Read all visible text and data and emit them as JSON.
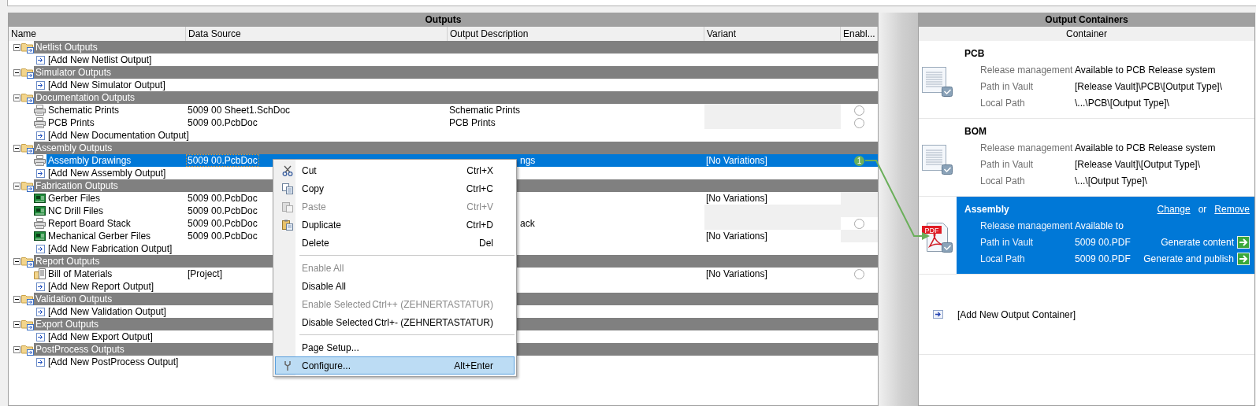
{
  "outputs": {
    "title": "Outputs",
    "columns": [
      "Name",
      "Data Source",
      "Output Description",
      "Variant",
      "Enabl..."
    ],
    "groups": [
      {
        "name": "Netlist Outputs",
        "expanded": true,
        "rows": [
          {
            "kind": "add",
            "name": "[Add New Netlist Output]",
            "selected": false
          }
        ]
      },
      {
        "name": "Simulator Outputs",
        "expanded": true,
        "rows": [
          {
            "kind": "add",
            "name": "[Add New Simulator Output]",
            "selected": false
          }
        ]
      },
      {
        "name": "Documentation Outputs",
        "expanded": true,
        "rows": [
          {
            "kind": "print",
            "name": "Schematic Prints",
            "data_source": "5009 00 Sheet1.SchDoc",
            "description": "Schematic Prints",
            "description_covered": false,
            "variant_available": false,
            "enable_available": true,
            "enabled": false,
            "selected": false
          },
          {
            "kind": "print",
            "name": "PCB Prints",
            "data_source": "5009 00.PcbDoc",
            "description": "PCB Prints",
            "description_covered": false,
            "variant_available": false,
            "enable_available": true,
            "enabled": false,
            "selected": false
          },
          {
            "kind": "add",
            "name": "[Add New Documentation Output]",
            "selected": false
          }
        ]
      },
      {
        "name": "Assembly Outputs",
        "expanded": true,
        "rows": [
          {
            "kind": "print",
            "name": "Assembly Drawings",
            "data_source": "5009 00.PcbDoc",
            "description": "ngs",
            "description_covered": true,
            "variant": "[No Variations]",
            "variant_available": true,
            "enable_available": true,
            "enabled": true,
            "badge": "1",
            "selected": true
          },
          {
            "kind": "add",
            "name": "[Add New Assembly Output]",
            "selected": false
          }
        ]
      },
      {
        "name": "Fabrication Outputs",
        "expanded": true,
        "rows": [
          {
            "kind": "board",
            "name": "Gerber Files",
            "data_source": "5009 00.PcbDoc",
            "variant": "[No Variations]",
            "variant_available": true,
            "enable_available": false,
            "selected": false
          },
          {
            "kind": "board",
            "name": "NC Drill Files",
            "data_source": "5009 00.PcbDoc",
            "variant_available": false,
            "enable_available": false,
            "selected": false
          },
          {
            "kind": "print",
            "name": "Report Board Stack",
            "data_source": "5009 00.PcbDoc",
            "description": "ack",
            "description_covered": true,
            "variant_available": false,
            "enable_available": true,
            "enabled": false,
            "selected": false
          },
          {
            "kind": "board",
            "name": "Mechanical Gerber Files",
            "data_source": "5009 00.PcbDoc",
            "variant": "[No Variations]",
            "variant_available": true,
            "enable_available": false,
            "selected": false
          },
          {
            "kind": "add",
            "name": "[Add New Fabrication Output]",
            "selected": false
          }
        ]
      },
      {
        "name": "Report Outputs",
        "expanded": true,
        "rows": [
          {
            "kind": "report",
            "name": "Bill of Materials",
            "data_source": "[Project]",
            "variant": "[No Variations]",
            "variant_available": true,
            "enable_available": true,
            "enabled": false,
            "selected": false
          },
          {
            "kind": "add",
            "name": "[Add New Report Output]",
            "selected": false
          }
        ]
      },
      {
        "name": "Validation Outputs",
        "expanded": true,
        "rows": [
          {
            "kind": "add",
            "name": "[Add New Validation Output]",
            "selected": false
          }
        ]
      },
      {
        "name": "Export Outputs",
        "expanded": true,
        "rows": [
          {
            "kind": "add",
            "name": "[Add New Export Output]",
            "selected": false
          }
        ]
      },
      {
        "name": "PostProcess Outputs",
        "expanded": true,
        "rows": [
          {
            "kind": "add",
            "name": "[Add New PostProcess Output]",
            "selected": false
          }
        ]
      }
    ]
  },
  "containers": {
    "title": "Output Containers",
    "column": "Container",
    "items": [
      {
        "kind": "document",
        "name": "PCB",
        "selected": false,
        "fields": [
          {
            "label": "Release management",
            "value": "Available to PCB Release system"
          },
          {
            "label": "Path in Vault",
            "value": "[Release Vault]\\PCB\\[Output Type]\\"
          },
          {
            "label": "Local Path",
            "value": "\\...\\PCB\\[Output Type]\\"
          }
        ]
      },
      {
        "kind": "document",
        "name": "BOM",
        "selected": false,
        "fields": [
          {
            "label": "Release management",
            "value": "Available to PCB Release system"
          },
          {
            "label": "Path in Vault",
            "value": "[Release Vault]\\[Output Type]\\"
          },
          {
            "label": "Local Path",
            "value": "\\...\\[Output Type]\\"
          }
        ]
      },
      {
        "kind": "pdf",
        "icon_text": "PDF",
        "name": "Assembly",
        "selected": true,
        "links": [
          "Change",
          "Remove"
        ],
        "link_separator": "or",
        "fields": [
          {
            "label": "Release management",
            "value": "Available to"
          },
          {
            "label": "Path in Vault",
            "value": "5009 00.PDF",
            "action": "Generate content"
          },
          {
            "label": "Local Path",
            "value": "5009 00.PDF",
            "action": "Generate and publish"
          }
        ]
      }
    ],
    "add": "[Add New Output Container]"
  },
  "context_menu": [
    {
      "kind": "cut",
      "label": "Cut",
      "shortcut": "Ctrl+X",
      "disabled": false,
      "selected": false
    },
    {
      "kind": "copy",
      "label": "Copy",
      "shortcut": "Ctrl+C",
      "disabled": false,
      "selected": false
    },
    {
      "kind": "paste",
      "label": "Paste",
      "shortcut": "Ctrl+V",
      "disabled": true,
      "selected": false
    },
    {
      "kind": "duplicate",
      "label": "Duplicate",
      "shortcut": "Ctrl+D",
      "disabled": false,
      "selected": false
    },
    {
      "kind": "plain",
      "label": "Delete",
      "shortcut": "Del",
      "disabled": false,
      "selected": false
    },
    {
      "kind": "separator"
    },
    {
      "kind": "plain",
      "label": "Enable All",
      "disabled": true,
      "selected": false
    },
    {
      "kind": "plain",
      "label": "Disable All",
      "disabled": false,
      "selected": false
    },
    {
      "kind": "plain",
      "label": "Enable Selected",
      "shortcut": "Ctrl++ (ZEHNERTASTATUR)",
      "disabled": true,
      "selected": false
    },
    {
      "kind": "plain",
      "label": "Disable Selected",
      "shortcut": "Ctrl+- (ZEHNERTASTATUR)",
      "disabled": false,
      "selected": false
    },
    {
      "kind": "separator"
    },
    {
      "kind": "plain",
      "label": "Page Setup...",
      "disabled": false,
      "selected": false
    },
    {
      "kind": "configure",
      "label": "Configure...",
      "shortcut": "Alt+Enter",
      "disabled": false,
      "selected": true
    }
  ]
}
